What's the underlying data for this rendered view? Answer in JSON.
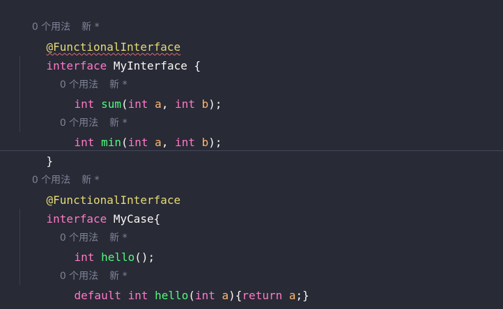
{
  "block1": {
    "usage_count": "0 个用法",
    "new_label": "新 *",
    "annotation": "@FunctionalInterface",
    "kw_interface": "interface",
    "name": "MyInterface",
    "open": " {",
    "method1": {
      "usage_count": "0 个用法",
      "new_label": "新 *",
      "ret": "int",
      "fn": "sum",
      "open": "(",
      "p1_type": "int",
      "p1_name": "a",
      "comma": ", ",
      "p2_type": "int",
      "p2_name": "b",
      "close": ");"
    },
    "method2": {
      "usage_count": "0 个用法",
      "new_label": "新 *",
      "ret": "int",
      "fn": "min",
      "open": "(",
      "p1_type": "int",
      "p1_name": "a",
      "comma": ", ",
      "p2_type": "int",
      "p2_name": "b",
      "close": ");"
    },
    "close": "}"
  },
  "block2": {
    "usage_count": "0 个用法",
    "new_label": "新 *",
    "annotation": "@FunctionalInterface",
    "kw_interface": "interface",
    "name": "MyCase",
    "open": "{",
    "method1": {
      "usage_count": "0 个用法",
      "new_label": "新 *",
      "ret": "int",
      "fn": "hello",
      "rest": "();"
    },
    "method2": {
      "usage_count": "0 个用法",
      "new_label": "新 *",
      "kw_default": "default",
      "ret": "int",
      "fn": "hello",
      "open": "(",
      "p1_type": "int",
      "p1_name": "a",
      "body_open": "){",
      "kw_return": "return",
      "ret_val": "a",
      "body_close": ";}"
    },
    "close": "}"
  },
  "theme": {
    "background": "#282a36",
    "keyword": "#ff79c6",
    "function": "#50fa7b",
    "parameter": "#ffb86c",
    "annotation": "#e6db74",
    "hint": "#7f8497"
  }
}
